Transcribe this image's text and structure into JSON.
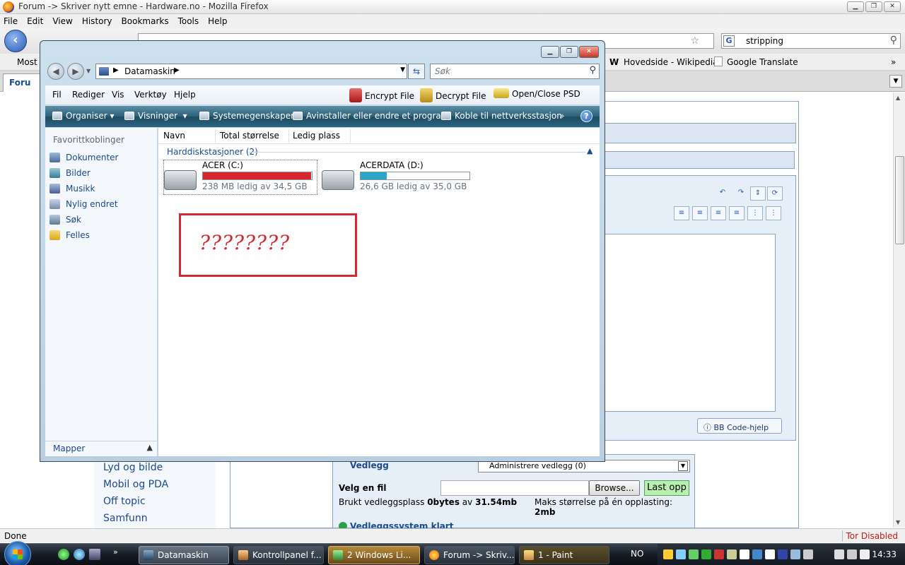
{
  "firefox": {
    "title": "Forum -> Skriver nytt emne - Hardware.no - Mozilla Firefox",
    "menu": [
      "File",
      "Edit",
      "View",
      "History",
      "Bookmarks",
      "Tools",
      "Help"
    ],
    "search_value": "stripping",
    "bookmarks": {
      "most": "Most V",
      "wikipedia": "Hovedside - Wikipedia",
      "translate": "Google Translate"
    },
    "tab_label": "Foru",
    "status": "Done",
    "tor_status": "Tor Disabled"
  },
  "page": {
    "bbcode_help": "BB Code-hjelp",
    "left_links": [
      "Lyd og bilde",
      "Mobil og PDA",
      "Off topic",
      "Samfunn"
    ],
    "attach": {
      "title": "Vedlegg",
      "select_value": "Administrere vedlegg (0)",
      "choose_file": "Velg en fil",
      "browse": "Browse...",
      "upload": "Last opp",
      "used_label": "Brukt vedleggsplass",
      "used_value": "0bytes",
      "of": "av",
      "used_total": "31.54mb",
      "max_label": "Maks størrelse på én opplasting:",
      "max_value": "2mb",
      "status": "Vedleggssystem klart"
    }
  },
  "explorer": {
    "address_text": "Datamaskin",
    "search_placeholder": "Søk",
    "menu": [
      "Fil",
      "Rediger",
      "Vis",
      "Verktøy",
      "Hjelp"
    ],
    "encrypt": "Encrypt File",
    "decrypt": "Decrypt File",
    "openclose": "Open/Close PSD",
    "commands": [
      "Organiser",
      "Visninger",
      "Systemegenskaper",
      "Avinstaller eller endre et program",
      "Koble til nettverksstasjon"
    ],
    "more": "»",
    "favorites_header": "Favorittkoblinger",
    "favorites": [
      "Dokumenter",
      "Bilder",
      "Musikk",
      "Nylig endret",
      "Søk",
      "Felles"
    ],
    "folders": "Mapper",
    "columns": [
      "Navn",
      "Total størrelse",
      "Ledig plass"
    ],
    "group": "Harddiskstasjoner (2)",
    "drives": [
      {
        "name": "ACER (C:)",
        "free_text": "238 MB ledig av 34,5 GB",
        "used_fraction": 0.993,
        "color": "#d8262e"
      },
      {
        "name": "ACERDATA (D:)",
        "free_text": "26,6 GB ledig av 35,0 GB",
        "used_fraction": 0.24,
        "color": "#2aa6c8"
      }
    ],
    "annotation": "????????"
  },
  "taskbar": {
    "quicklaunch_more": "»",
    "buttons": [
      "Datamaskin",
      "Kontrollpanel f...",
      "2 Windows Li...",
      "Forum -> Skriv...",
      "1 - Paint"
    ],
    "language": "NO",
    "clock": "14:33"
  }
}
